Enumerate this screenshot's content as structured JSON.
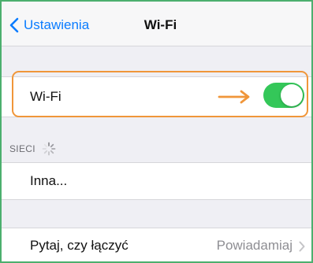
{
  "navbar": {
    "back_label": "Ustawienia",
    "title": "Wi-Fi"
  },
  "wifi": {
    "label": "Wi-Fi",
    "enabled": true
  },
  "networks": {
    "section_label": "SIECI",
    "other_label": "Inna..."
  },
  "ask_to_join": {
    "label": "Pytaj, czy łączyć",
    "value": "Powiadamiaj"
  },
  "colors": {
    "accent": "#0a7cff",
    "toggle_on": "#34c759",
    "highlight": "#f0963a",
    "frame_border": "#4caf6e"
  }
}
